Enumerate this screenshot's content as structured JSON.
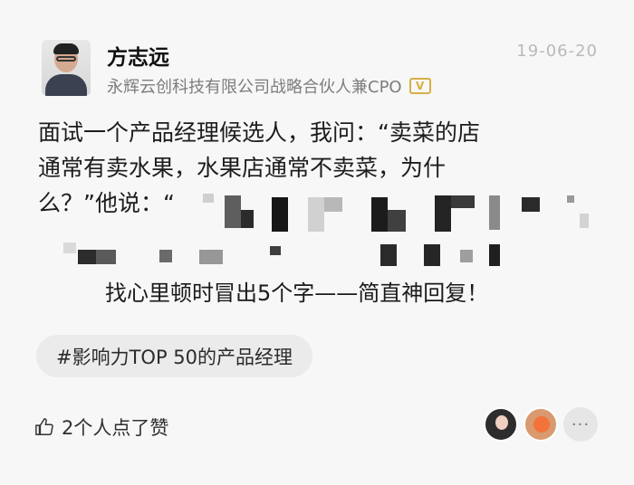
{
  "post": {
    "author_name": "方志远",
    "author_title": "永辉云创科技有限公司战略合伙人兼CPO",
    "verified_badge": "V",
    "date": "19-06-20",
    "content_lines": [
      "面试一个产品经理候选人，我问：“卖菜的店",
      "通常有卖水果，水果店通常不卖菜，为什",
      "么？”他说：“"
    ],
    "highlight": "找心里顿时冒出5个字——简直神回复！",
    "tag": "#影响力TOP 50的产品经理",
    "like_text": "2个人点了赞",
    "more_label": "···"
  },
  "icons": {
    "avatar": "author-avatar",
    "verified": "verified-badge-icon",
    "like": "thumbs-up-icon",
    "more": "more-dots-icon"
  },
  "colors": {
    "background": "#f7f7f7",
    "badge": "#d5b045",
    "tag_bg": "#ebebeb",
    "date": "#b9b9b9"
  }
}
